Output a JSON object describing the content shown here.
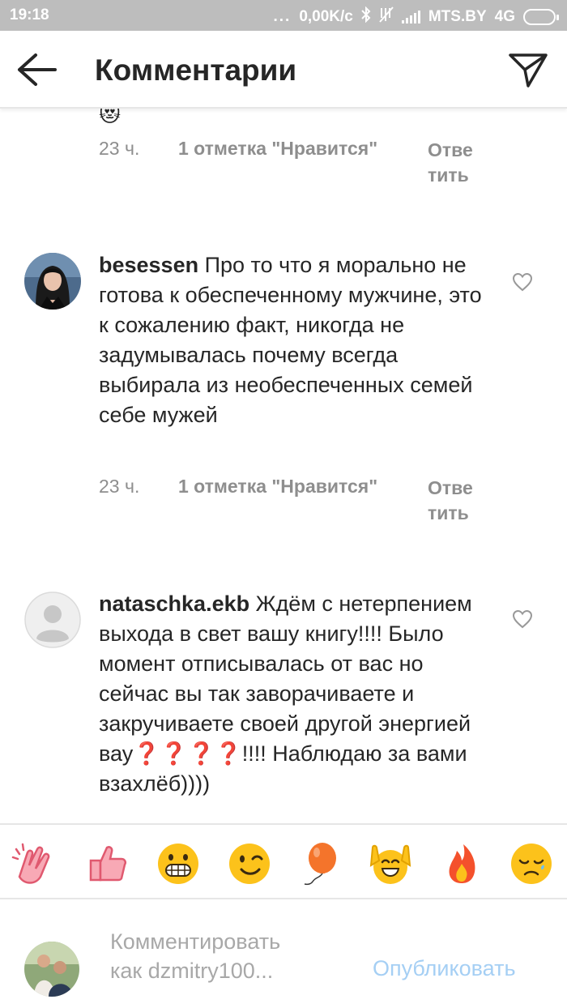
{
  "status_bar": {
    "time": "19:18",
    "dots": "...",
    "speed": "0,00K/c",
    "carrier": "MTS.BY",
    "network": "4G",
    "icons": [
      "bluetooth-icon",
      "no-sound-icon",
      "signal-icon",
      "battery-icon"
    ]
  },
  "header": {
    "title": "Комментарии",
    "back_icon": "arrow-left-icon",
    "send_icon": "paper-plane-icon"
  },
  "comments": [
    {
      "partial_emoji": "😻",
      "time": "23 ч.",
      "likes": "1 отметка \"Нравится\"",
      "reply": "Ответить"
    },
    {
      "username": "besessen",
      "text": "Про то что я морально не готова к обеспеченному мужчине, это к сожалению факт, никогда не задумывалась почему всегда выбирала из необеспеченных семей себе мужей",
      "time": "23 ч.",
      "likes": "1 отметка \"Нравится\"",
      "reply": "Ответить",
      "avatar": "user-photo"
    },
    {
      "username": "nataschka.ekb",
      "text": "Ждём с нетерпением выхода в свет вашу книгу!!!! Было момент отписывалась от вас но сейчас вы так заворачиваете и закручиваете своей другой энергией вау❓❓❓❓!!!! Наблюдаю за вами взахлёб))))",
      "avatar": "default-avatar"
    }
  ],
  "emoji_bar": [
    "🙌👏",
    "👍",
    "😁",
    "😉",
    "🎈",
    "🙌",
    "🔥",
    "😞"
  ],
  "composer": {
    "placeholder_line1": "Комментировать",
    "placeholder_line2": "как dzmitry100...",
    "publish_label": "Опубликовать"
  },
  "colors": {
    "status_bar_bg": "#bdbdbd",
    "text": "#262626",
    "secondary_text": "#8e8e8e",
    "publish_disabled": "#a5cff4"
  }
}
